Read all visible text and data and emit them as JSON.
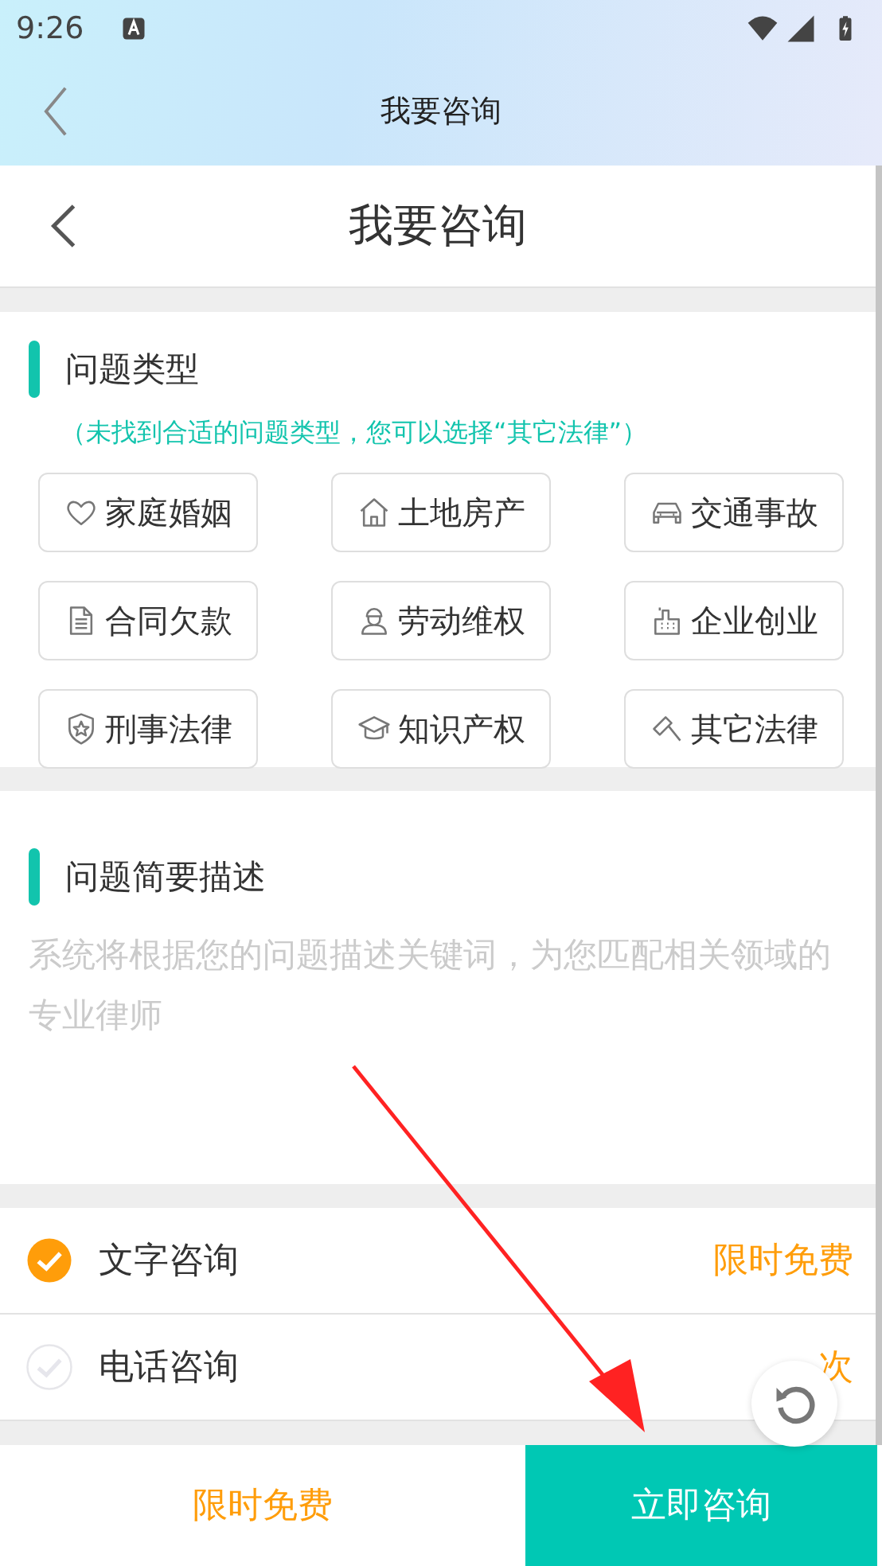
{
  "status_bar": {
    "time": "9:26"
  },
  "app_bar": {
    "title": "我要咨询"
  },
  "page_header": {
    "title": "我要咨询"
  },
  "problem_type": {
    "title": "问题类型",
    "hint": "（未找到合适的问题类型，您可以选择“其它法律”）",
    "categories": [
      {
        "label": "家庭婚姻"
      },
      {
        "label": "土地房产"
      },
      {
        "label": "交通事故"
      },
      {
        "label": "合同欠款"
      },
      {
        "label": "劳动维权"
      },
      {
        "label": "企业创业"
      },
      {
        "label": "刑事法律"
      },
      {
        "label": "知识产权"
      },
      {
        "label": "其它法律"
      }
    ]
  },
  "description": {
    "title": "问题简要描述",
    "placeholder": "系统将根据您的问题描述关键词，为您匹配相关领域的专业律师"
  },
  "consult_options": [
    {
      "label": "文字咨询",
      "price": "限时免费",
      "selected": true
    },
    {
      "label": "电话咨询",
      "price": "次",
      "selected": false
    }
  ],
  "bottom_bar": {
    "price": "限时免费",
    "submit": "立即咨询"
  }
}
